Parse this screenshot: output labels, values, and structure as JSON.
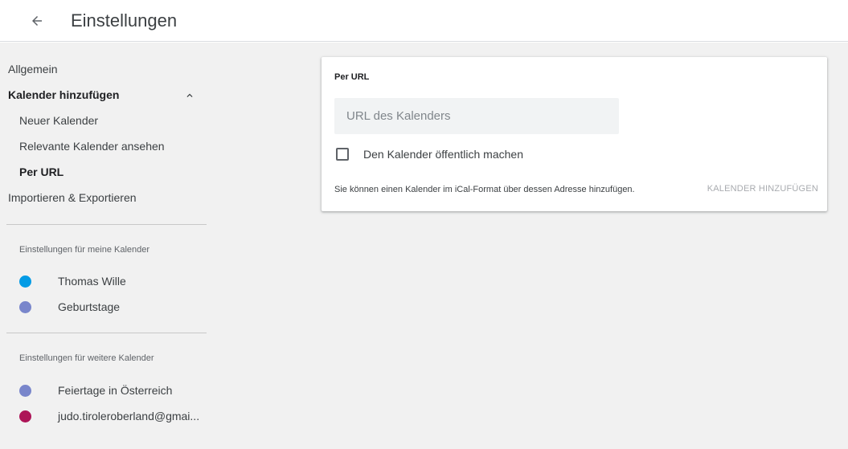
{
  "header": {
    "title": "Einstellungen",
    "back_icon": "arrow-left-icon"
  },
  "sidebar": {
    "nav": [
      {
        "label": "Allgemein",
        "bold": false
      },
      {
        "label": "Kalender hinzufügen",
        "bold": true,
        "expanded": true
      },
      {
        "label": "Neuer Kalender",
        "bold": false,
        "sub": true
      },
      {
        "label": "Relevante Kalender ansehen",
        "bold": false,
        "sub": true
      },
      {
        "label": "Per URL",
        "bold": true,
        "sub": true,
        "selected": true
      },
      {
        "label": "Importieren & Exportieren",
        "bold": false
      }
    ],
    "my_calendars_title": "Einstellungen für meine Kalender",
    "my_calendars": [
      {
        "name": "Thomas Wille",
        "color": "#039be5"
      },
      {
        "name": "Geburtstage",
        "color": "#7986cb"
      }
    ],
    "other_calendars_title": "Einstellungen für weitere Kalender",
    "other_calendars": [
      {
        "name": "Feiertage in Österreich",
        "color": "#7986cb"
      },
      {
        "name": "judo.tiroleroberland@gmai...",
        "color": "#ad1457"
      }
    ]
  },
  "card": {
    "title": "Per URL",
    "url_placeholder": "URL des Kalenders",
    "url_value": "",
    "checkbox_label": "Den Kalender öffentlich machen",
    "checkbox_checked": false,
    "help_text": "Sie können einen Kalender im iCal-Format über dessen Adresse hinzufügen.",
    "add_button_label": "KALENDER HINZUFÜGEN"
  },
  "colors": {
    "background": "#f1f1f1",
    "card": "#ffffff",
    "disabled_text": "#a8abaf"
  }
}
